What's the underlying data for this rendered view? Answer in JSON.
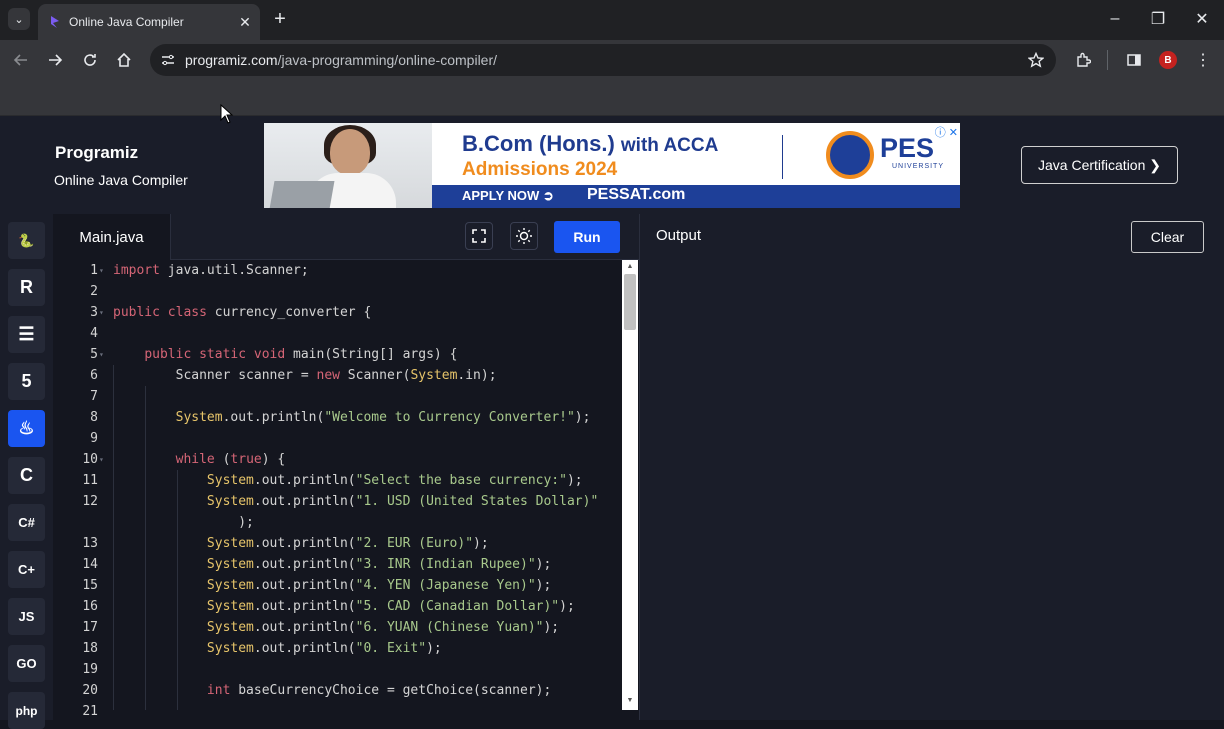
{
  "browser": {
    "tab_title": "Online Java Compiler",
    "url_host": "programiz.com",
    "url_path": "/java-programming/online-compiler/",
    "profile_initial": "B"
  },
  "header": {
    "logo": "Programiz",
    "subtitle": "Online Java Compiler",
    "cert_button": "Java Certification ❯"
  },
  "ad": {
    "headline_big": "B.Com (Hons.)",
    "headline_small": "with ACCA",
    "sub": "Admissions 2024",
    "apply": "APPLY NOW ➲",
    "pessat": "PESSAT.com",
    "brand": "PES",
    "brand_sub": "UNIVERSITY",
    "icons": "ⓘ ✕"
  },
  "sidebar": {
    "items": [
      {
        "name": "python-icon",
        "glyph": "🐍"
      },
      {
        "name": "r-icon",
        "glyph": "R"
      },
      {
        "name": "sql-icon",
        "glyph": "☰"
      },
      {
        "name": "html-icon",
        "glyph": "5"
      },
      {
        "name": "java-icon",
        "glyph": "♨"
      },
      {
        "name": "c-icon",
        "glyph": "C"
      },
      {
        "name": "csharp-icon",
        "glyph": "C#"
      },
      {
        "name": "cpp-icon",
        "glyph": "C+"
      },
      {
        "name": "js-icon",
        "glyph": "JS"
      },
      {
        "name": "go-icon",
        "glyph": "GO"
      },
      {
        "name": "php-icon",
        "glyph": "php"
      }
    ]
  },
  "editor": {
    "file_name": "Main.java",
    "run_label": "Run",
    "lines": [
      {
        "n": "1",
        "fold": true,
        "tokens": [
          [
            "kw",
            "import"
          ],
          [
            "plain",
            " java.util.Scanner;"
          ]
        ]
      },
      {
        "n": "2",
        "tokens": []
      },
      {
        "n": "3",
        "fold": true,
        "tokens": [
          [
            "kw",
            "public class"
          ],
          [
            "plain",
            " currency_converter {"
          ]
        ]
      },
      {
        "n": "4",
        "tokens": []
      },
      {
        "n": "5",
        "fold": true,
        "tokens": [
          [
            "plain",
            "    "
          ],
          [
            "kw",
            "public static void"
          ],
          [
            "plain",
            " main(String[] args) {"
          ]
        ]
      },
      {
        "n": "6",
        "tokens": [
          [
            "plain",
            "        Scanner scanner = "
          ],
          [
            "kw",
            "new"
          ],
          [
            "plain",
            " Scanner("
          ],
          [
            "cls",
            "System"
          ],
          [
            "plain",
            ".in);"
          ]
        ]
      },
      {
        "n": "7",
        "tokens": []
      },
      {
        "n": "8",
        "tokens": [
          [
            "plain",
            "        "
          ],
          [
            "cls",
            "System"
          ],
          [
            "plain",
            ".out.println("
          ],
          [
            "str",
            "\"Welcome to Currency Converter!\""
          ],
          [
            "plain",
            ");"
          ]
        ]
      },
      {
        "n": "9",
        "tokens": []
      },
      {
        "n": "10",
        "fold": true,
        "tokens": [
          [
            "plain",
            "        "
          ],
          [
            "kw",
            "while"
          ],
          [
            "plain",
            " ("
          ],
          [
            "kw",
            "true"
          ],
          [
            "plain",
            ") {"
          ]
        ]
      },
      {
        "n": "11",
        "tokens": [
          [
            "plain",
            "            "
          ],
          [
            "cls",
            "System"
          ],
          [
            "plain",
            ".out.println("
          ],
          [
            "str",
            "\"Select the base currency:\""
          ],
          [
            "plain",
            ");"
          ]
        ]
      },
      {
        "n": "12",
        "tokens": [
          [
            "plain",
            "            "
          ],
          [
            "cls",
            "System"
          ],
          [
            "plain",
            ".out.println("
          ],
          [
            "str",
            "\"1. USD (United States Dollar)\""
          ]
        ]
      },
      {
        "n": "",
        "tokens": [
          [
            "plain",
            "                );"
          ]
        ]
      },
      {
        "n": "13",
        "tokens": [
          [
            "plain",
            "            "
          ],
          [
            "cls",
            "System"
          ],
          [
            "plain",
            ".out.println("
          ],
          [
            "str",
            "\"2. EUR (Euro)\""
          ],
          [
            "plain",
            ");"
          ]
        ]
      },
      {
        "n": "14",
        "tokens": [
          [
            "plain",
            "            "
          ],
          [
            "cls",
            "System"
          ],
          [
            "plain",
            ".out.println("
          ],
          [
            "str",
            "\"3. INR (Indian Rupee)\""
          ],
          [
            "plain",
            ");"
          ]
        ]
      },
      {
        "n": "15",
        "tokens": [
          [
            "plain",
            "            "
          ],
          [
            "cls",
            "System"
          ],
          [
            "plain",
            ".out.println("
          ],
          [
            "str",
            "\"4. YEN (Japanese Yen)\""
          ],
          [
            "plain",
            ");"
          ]
        ]
      },
      {
        "n": "16",
        "tokens": [
          [
            "plain",
            "            "
          ],
          [
            "cls",
            "System"
          ],
          [
            "plain",
            ".out.println("
          ],
          [
            "str",
            "\"5. CAD (Canadian Dollar)\""
          ],
          [
            "plain",
            ");"
          ]
        ]
      },
      {
        "n": "17",
        "tokens": [
          [
            "plain",
            "            "
          ],
          [
            "cls",
            "System"
          ],
          [
            "plain",
            ".out.println("
          ],
          [
            "str",
            "\"6. YUAN (Chinese Yuan)\""
          ],
          [
            "plain",
            ");"
          ]
        ]
      },
      {
        "n": "18",
        "tokens": [
          [
            "plain",
            "            "
          ],
          [
            "cls",
            "System"
          ],
          [
            "plain",
            ".out.println("
          ],
          [
            "str",
            "\"0. Exit\""
          ],
          [
            "plain",
            ");"
          ]
        ]
      },
      {
        "n": "19",
        "tokens": []
      },
      {
        "n": "20",
        "tokens": [
          [
            "plain",
            "            "
          ],
          [
            "kw",
            "int"
          ],
          [
            "plain",
            " baseCurrencyChoice = getChoice(scanner);"
          ]
        ]
      },
      {
        "n": "21",
        "tokens": []
      }
    ]
  },
  "output": {
    "title": "Output",
    "clear_label": "Clear"
  },
  "colors": {
    "accent": "#1a55f0",
    "keyword": "#d56576",
    "class": "#e6c46a",
    "string": "#a8c98c"
  }
}
